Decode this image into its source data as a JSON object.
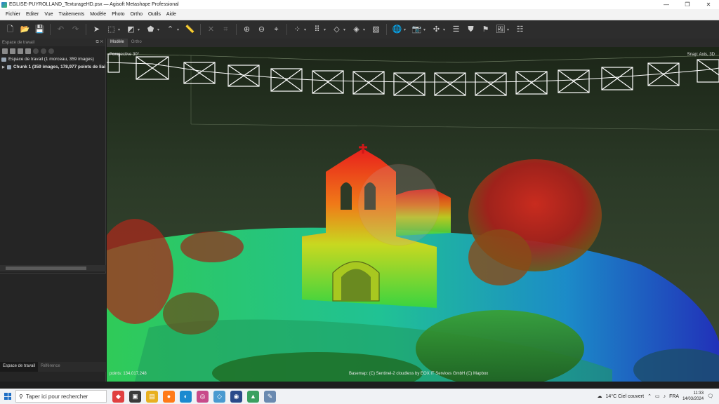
{
  "window": {
    "title": "EGLISE-PUYROLLAND_TexturageHD.psx — Agisoft Metashape Professional",
    "controls": [
      "—",
      "❐",
      "✕"
    ]
  },
  "menu": [
    "Fichier",
    "Editer",
    "Vue",
    "Traitements",
    "Modèle",
    "Photo",
    "Ortho",
    "Outils",
    "Aide"
  ],
  "workspace": {
    "panel_title": "Espace de travail",
    "root_label": "Espace de travail (1 morceau, 359 images)",
    "chunk_label": "Chunk 1 (359 images, 178,977 points de liai",
    "tabs": [
      "Espace de travail",
      "Référence"
    ]
  },
  "view_tabs": [
    "Modèle",
    "Ortho"
  ],
  "viewport": {
    "projection_label": "Perspective 30°",
    "snap_label": "Snap: Axis, 3D",
    "points_label": "points: 134,017,248",
    "basemap_label": "Basemap: (C) Sentinel-2 cloudless by EOX IT Services GmbH (C) Mapbox"
  },
  "taskbar": {
    "search_placeholder": "Taper ici pour rechercher",
    "weather": "14°C  Ciel couvert",
    "language": "FRA",
    "time": "11:33",
    "date": "14/03/2024"
  },
  "colors": {
    "toolbar_bg": "#2d2d2d",
    "panel_bg": "#252525",
    "accent_blue": "#1f6fc5"
  }
}
